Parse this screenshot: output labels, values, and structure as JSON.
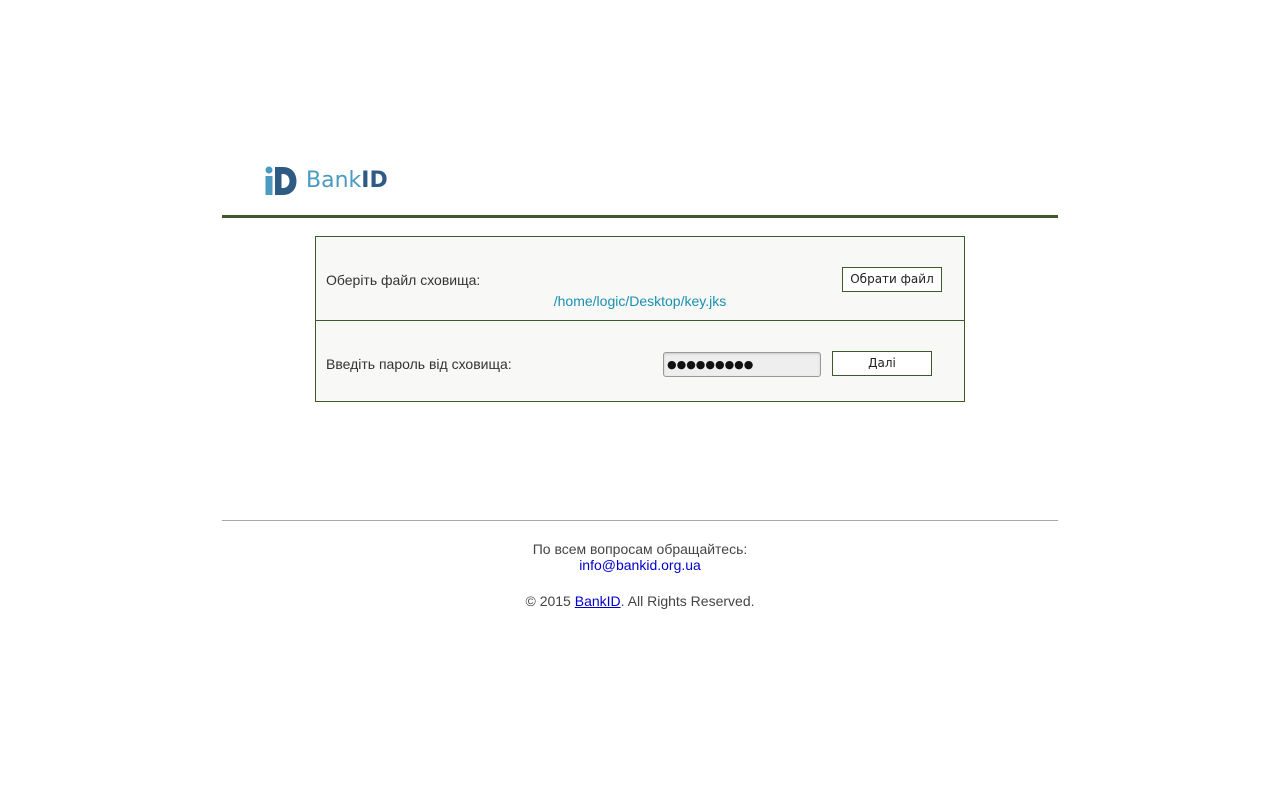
{
  "logo": {
    "text_bank": "Bank",
    "text_id": "ID",
    "colors": {
      "bank": "#4a9bbf",
      "id": "#2e5a84"
    }
  },
  "form": {
    "file_label": "Оберіть файл сховища:",
    "file_path": "/home/logic/Desktop/key.jks",
    "choose_button": "Обрати файл",
    "password_label": "Введіть пароль від сховища:",
    "password_masked": "●●●●●●●●●",
    "next_button": "Далі"
  },
  "footer": {
    "contact_text": "По всем вопросам обращайтесь:",
    "contact_email": "info@bankid.org.ua",
    "copyright_prefix": "© 2015 ",
    "copyright_link": "BankID",
    "copyright_suffix": ". All Rights Reserved."
  },
  "colors": {
    "accent_green": "#3d5a2a",
    "link_path": "#1a8fb0",
    "link_blue": "#0000cc"
  }
}
